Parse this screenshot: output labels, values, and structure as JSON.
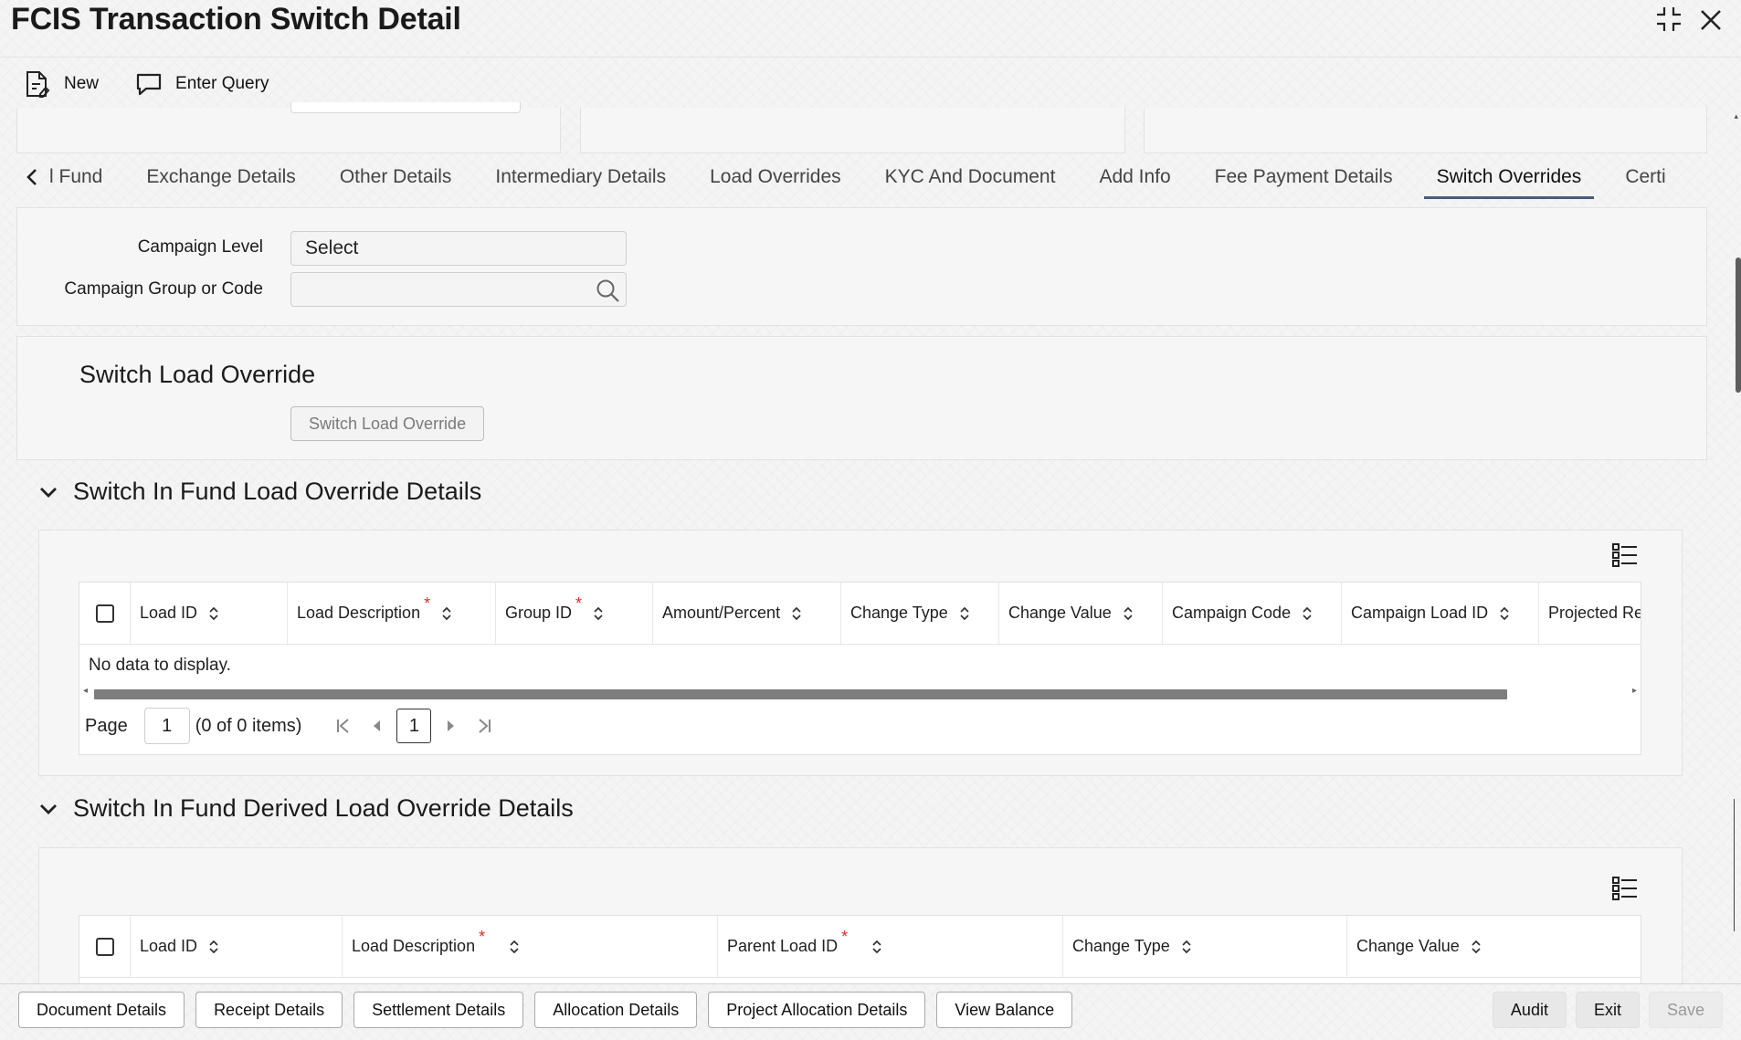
{
  "window": {
    "title": "FCIS Transaction Switch Detail",
    "restore_glyph": "⛶",
    "close_glyph": "✕"
  },
  "toolbar": {
    "new_label": "New",
    "enter_query_label": "Enter Query"
  },
  "tabs": {
    "items": [
      {
        "label": "l Fund"
      },
      {
        "label": "Exchange Details"
      },
      {
        "label": "Other Details"
      },
      {
        "label": "Intermediary Details"
      },
      {
        "label": "Load Overrides"
      },
      {
        "label": "KYC And Document"
      },
      {
        "label": "Add Info"
      },
      {
        "label": "Fee Payment Details"
      },
      {
        "label": "Switch Overrides"
      },
      {
        "label": "Certi"
      }
    ],
    "active_index": 8
  },
  "campaign": {
    "level_label": "Campaign Level",
    "level_value": "Select",
    "group_label": "Campaign Group or Code",
    "group_value": ""
  },
  "switch_load_override": {
    "title": "Switch Load Override",
    "button_label": "Switch Load Override"
  },
  "load_override_table": {
    "title": "Switch In Fund Load Override Details",
    "columns": [
      {
        "label": "Load ID",
        "required": false
      },
      {
        "label": "Load Description",
        "required": true
      },
      {
        "label": "Group ID",
        "required": true
      },
      {
        "label": "Amount/Percent",
        "required": false
      },
      {
        "label": "Change Type",
        "required": false
      },
      {
        "label": "Change Value",
        "required": false
      },
      {
        "label": "Campaign Code",
        "required": false
      },
      {
        "label": "Campaign Load ID",
        "required": false
      },
      {
        "label": "Projected Re",
        "required": false
      }
    ],
    "no_data_text": "No data to display.",
    "pager": {
      "page_label": "Page",
      "page_value": "1",
      "items_text": "(0 of 0 items)",
      "current_page": "1"
    }
  },
  "derived_table": {
    "title": "Switch In Fund Derived Load Override Details",
    "columns": [
      {
        "label": "Load ID",
        "required": false
      },
      {
        "label": "Load Description",
        "required": true
      },
      {
        "label": "Parent Load ID",
        "required": true
      },
      {
        "label": "Change Type",
        "required": false
      },
      {
        "label": "Change Value",
        "required": false
      }
    ]
  },
  "footer": {
    "left_buttons": [
      "Document Details",
      "Receipt Details",
      "Settlement Details",
      "Allocation Details",
      "Project Allocation Details",
      "View Balance"
    ],
    "audit_label": "Audit",
    "exit_label": "Exit",
    "save_label": "Save"
  },
  "colors": {
    "active_tab_underline": "#4a5a7a",
    "required_asterisk": "#d0312d"
  }
}
